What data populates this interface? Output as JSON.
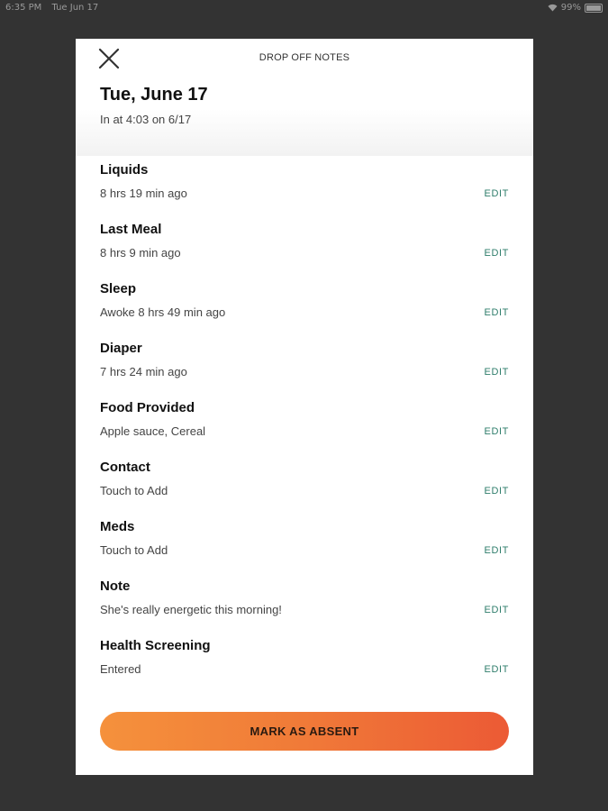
{
  "status_bar": {
    "time": "6:35 PM",
    "date": "Tue Jun 17",
    "battery": "99%"
  },
  "modal": {
    "title": "DROP OFF NOTES",
    "date": "Tue, June 17",
    "checkin": "In at 4:03 on 6/17",
    "edit_label": "EDIT",
    "rows": [
      {
        "title": "Liquids",
        "value": "8 hrs 19 min ago"
      },
      {
        "title": "Last Meal",
        "value": "8 hrs 9 min ago"
      },
      {
        "title": "Sleep",
        "value": "Awoke 8 hrs 49 min ago"
      },
      {
        "title": "Diaper",
        "value": "7 hrs 24 min ago"
      },
      {
        "title": "Food Provided",
        "value": "Apple sauce, Cereal"
      },
      {
        "title": "Contact",
        "value": "Touch to Add"
      },
      {
        "title": "Meds",
        "value": "Touch to Add"
      },
      {
        "title": "Note",
        "value": "She's really energetic this morning!"
      },
      {
        "title": "Health Screening",
        "value": "Entered"
      }
    ],
    "absent_button": "MARK AS ABSENT"
  },
  "colors": {
    "background": "#333333",
    "edit_accent": "#2e7d6b",
    "button_gradient_start": "#f5913c",
    "button_gradient_end": "#ec5a35"
  }
}
